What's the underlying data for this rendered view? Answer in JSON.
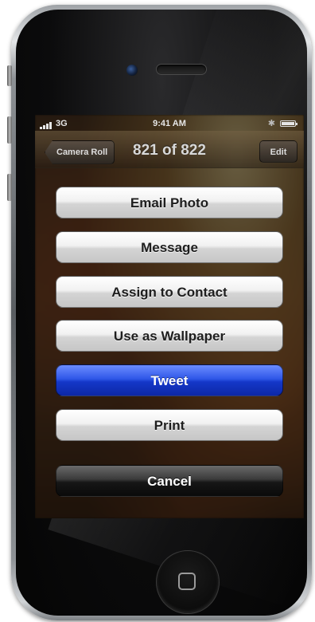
{
  "status_bar": {
    "network": "3G",
    "time": "9:41 AM"
  },
  "nav_bar": {
    "back_label": "Camera Roll",
    "title": "821 of 822",
    "edit_label": "Edit"
  },
  "action_sheet": {
    "buttons": [
      {
        "label": "Email Photo",
        "style": "light"
      },
      {
        "label": "Message",
        "style": "light"
      },
      {
        "label": "Assign to Contact",
        "style": "light"
      },
      {
        "label": "Use as Wallpaper",
        "style": "light"
      },
      {
        "label": "Tweet",
        "style": "blue"
      },
      {
        "label": "Print",
        "style": "light"
      }
    ],
    "cancel_label": "Cancel"
  },
  "icons": {
    "signal": "signal-bars-icon",
    "bluetooth": "bluetooth-icon",
    "battery": "battery-icon",
    "home": "home-button-icon"
  },
  "colors": {
    "tweet_blue": "#1437c8",
    "button_light": "#f1f1f1",
    "cancel_dark": "#161616"
  }
}
